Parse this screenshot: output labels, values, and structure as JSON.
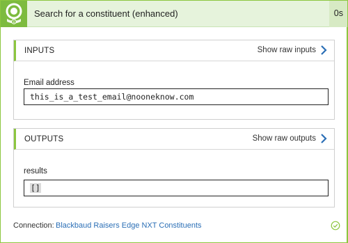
{
  "header": {
    "title": "Search for a constituent (enhanced)",
    "duration": "0s",
    "accent_color": "#7dbb3f",
    "icon": "connector-person-icon"
  },
  "inputs": {
    "section_title": "INPUTS",
    "raw_link_label": "Show raw inputs",
    "field_label": "Email address",
    "field_value": "this_is_a_test_email@nooneknow.com"
  },
  "outputs": {
    "section_title": "OUTPUTS",
    "raw_link_label": "Show raw outputs",
    "field_label": "results",
    "field_value": "[]"
  },
  "footer": {
    "connection_label": "Connection:",
    "connection_name": "Blackbaud Raisers Edge NXT Constituents",
    "status_icon": "check-circle-icon",
    "link_color": "#2b6fb6"
  }
}
